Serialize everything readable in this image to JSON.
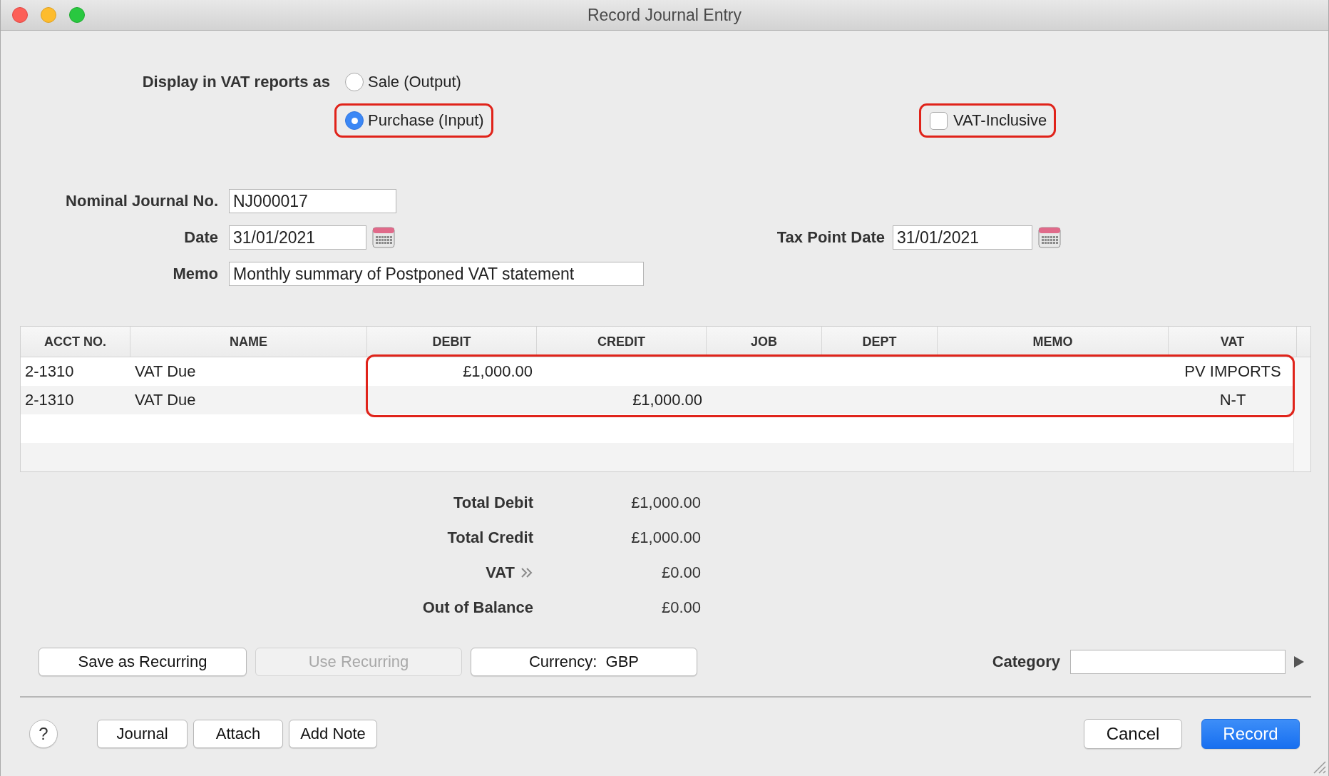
{
  "window": {
    "title": "Record Journal Entry"
  },
  "vat_report_type": {
    "label": "Display in VAT reports as",
    "options": [
      {
        "label": "Sale (Output)",
        "selected": false,
        "highlighted": false
      },
      {
        "label": "Purchase (Input)",
        "selected": true,
        "highlighted": true
      }
    ]
  },
  "vat_inclusive": {
    "label": "VAT-Inclusive",
    "checked": false,
    "highlighted": true
  },
  "nominal_journal_no": {
    "label": "Nominal Journal No.",
    "value": "NJ000017"
  },
  "date": {
    "label": "Date",
    "value": "31/01/2021"
  },
  "tax_point_date": {
    "label": "Tax Point Date",
    "value": "31/01/2021"
  },
  "memo": {
    "label": "Memo",
    "value": "Monthly summary of Postponed VAT statement"
  },
  "table": {
    "columns": [
      "ACCT NO.",
      "NAME",
      "DEBIT",
      "CREDIT",
      "JOB",
      "DEPT",
      "MEMO",
      "VAT"
    ],
    "rows": [
      {
        "cells": [
          "2-1310",
          "VAT Due",
          "£1,000.00",
          "",
          "",
          "",
          "",
          "PV IMPORTS"
        ],
        "highlighted": true
      },
      {
        "cells": [
          "2-1310",
          "VAT Due",
          "",
          "£1,000.00",
          "",
          "",
          "",
          "N-T"
        ],
        "highlighted": true
      }
    ]
  },
  "totals": [
    {
      "label": "Total Debit",
      "value": "£1,000.00",
      "kind": "plain"
    },
    {
      "label": "Total Credit",
      "value": "£1,000.00",
      "kind": "plain"
    },
    {
      "label": "VAT",
      "value": "£0.00",
      "kind": "expandable"
    },
    {
      "label": "Out of Balance",
      "value": "£0.00",
      "kind": "plain"
    }
  ],
  "action_buttons": [
    {
      "label": "Save as Recurring",
      "disabled": false
    },
    {
      "label": "Use Recurring",
      "disabled": true
    },
    {
      "label": "Currency:  GBP",
      "disabled": false
    }
  ],
  "category": {
    "label": "Category"
  },
  "help_button": {
    "label": "?"
  },
  "footer_left_buttons": [
    "Journal",
    "Attach",
    "Add Note"
  ],
  "footer_right_buttons": [
    {
      "label": "Cancel",
      "default": false
    },
    {
      "label": "Record",
      "default": true
    }
  ]
}
